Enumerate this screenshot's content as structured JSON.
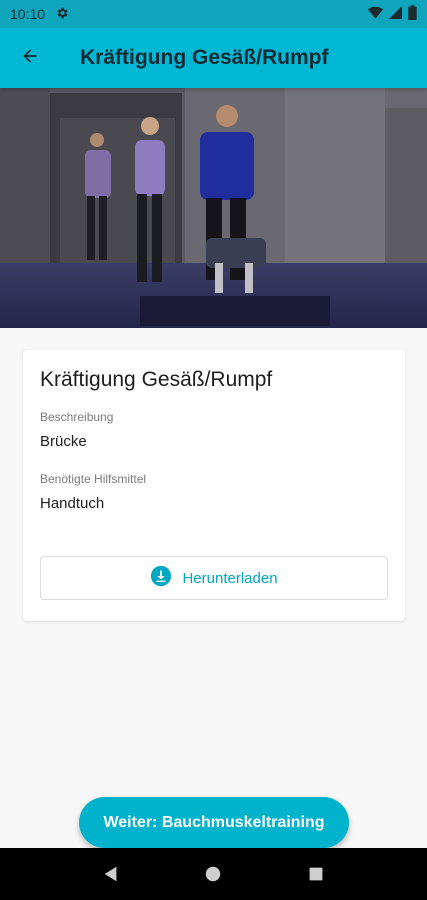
{
  "status_bar": {
    "time": "10:10"
  },
  "app_bar": {
    "title": "Kräftigung Gesäß/Rumpf"
  },
  "exercise": {
    "title": "Kräftigung Gesäß/Rumpf",
    "description_label": "Beschreibung",
    "description_value": "Brücke",
    "equipment_label": "Benötigte Hilfsmittel",
    "equipment_value": "Handtuch",
    "download_label": "Herunterladen"
  },
  "next_button": {
    "label": "Weiter: Bauchmuskeltraining"
  },
  "colors": {
    "accent": "#00b8d4",
    "button_accent": "#00a7c0"
  }
}
